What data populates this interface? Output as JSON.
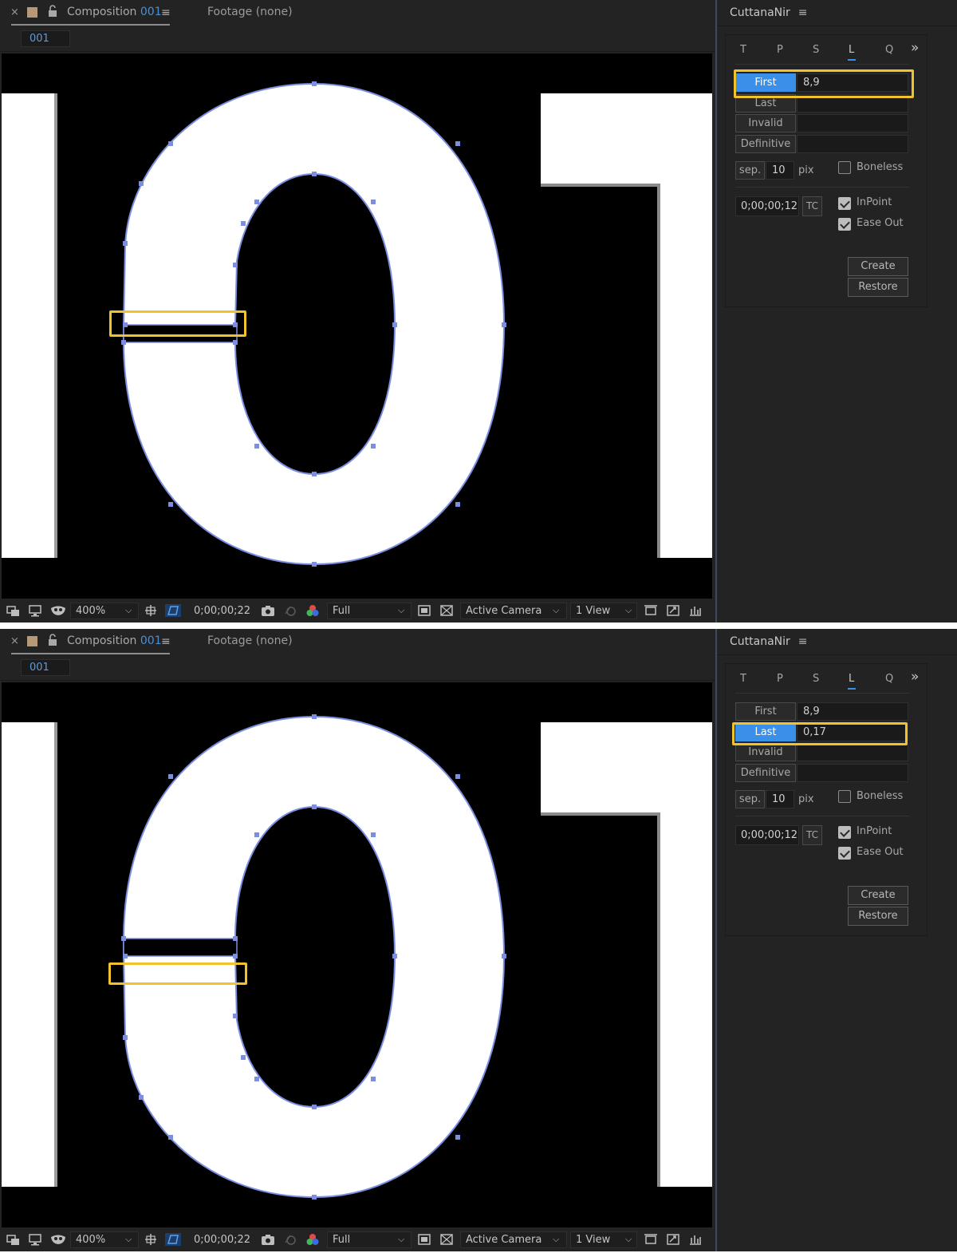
{
  "comp_tab": {
    "close": "×",
    "title_prefix": "Composition",
    "title_name": "001",
    "menu": "≡"
  },
  "footage_tab": "Footage  (none)",
  "comp_subtab": "001",
  "viewer_bar": {
    "zoom": "400%",
    "timecode": "0;00;00;22",
    "resolution": "Full",
    "camera": "Active Camera",
    "views": "1 View"
  },
  "plugin": {
    "title": "CuttanaNir",
    "menu": "≡",
    "tabs": [
      "T",
      "P",
      "S",
      "L",
      "Q"
    ],
    "active_tab": "L",
    "more": "»",
    "rows": [
      "First",
      "Last",
      "Invalid",
      "Definitive"
    ],
    "sep_label": "sep.",
    "sep_value": "10",
    "pix_label": "pix",
    "boneless_label": "Boneless",
    "tc_value": "0;00;00;12",
    "tc_button": "TC",
    "inpoint_label": "InPoint",
    "easeout_label": "Ease Out",
    "create_label": "Create",
    "restore_label": "Restore"
  },
  "frames": [
    {
      "selected_row": "First",
      "values": {
        "First": "8,9",
        "Last": "",
        "Invalid": "",
        "Definitive": ""
      },
      "boneless_checked": false,
      "inpoint_checked": true,
      "easeout_checked": true
    },
    {
      "selected_row": "Last",
      "values": {
        "First": "8,9",
        "Last": "0,17",
        "Invalid": "",
        "Definitive": ""
      },
      "boneless_checked": false,
      "inpoint_checked": true,
      "easeout_checked": true
    }
  ],
  "colors": {
    "highlight": "#f2c22d",
    "accent": "#3a8fe8",
    "path": "#7c8ee0"
  }
}
